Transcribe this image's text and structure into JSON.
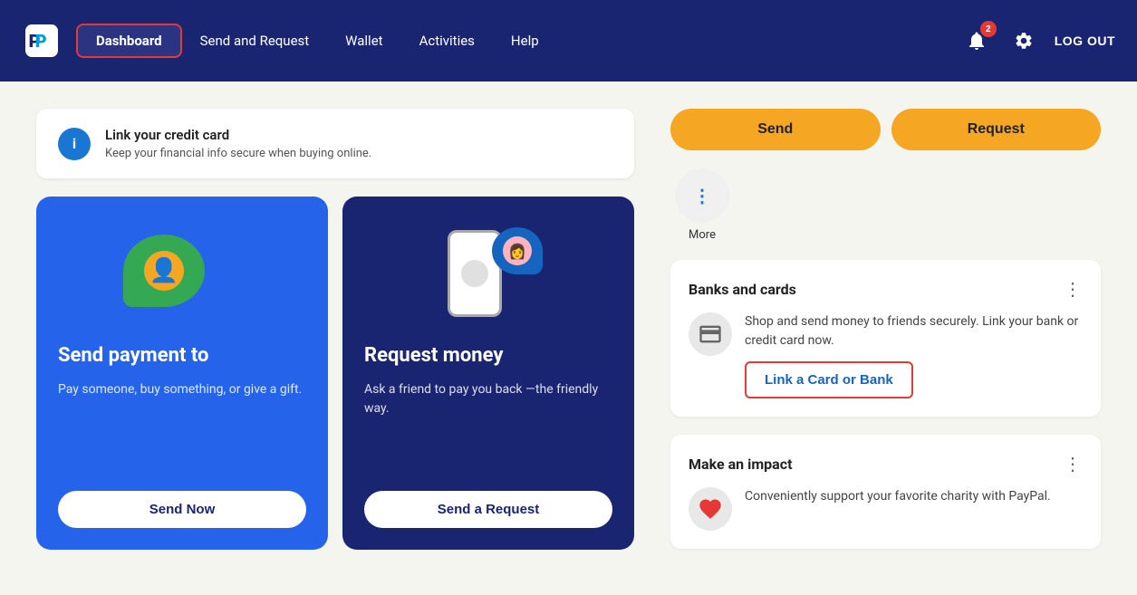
{
  "navbar": {
    "logo_alt": "PayPal",
    "items": [
      {
        "label": "Dashboard",
        "active": true
      },
      {
        "label": "Send and Request",
        "active": false
      },
      {
        "label": "Wallet",
        "active": false
      },
      {
        "label": "Activities",
        "active": false
      },
      {
        "label": "Help",
        "active": false
      }
    ],
    "notification_count": "2",
    "logout_label": "LOG OUT"
  },
  "info_banner": {
    "title": "Link your credit card",
    "description": "Keep your financial info secure when buying online."
  },
  "send_card": {
    "title": "Send payment to",
    "description": "Pay someone, buy something, or give a gift.",
    "button_label": "Send Now"
  },
  "request_card": {
    "title": "Request money",
    "description": "Ask a friend to pay you back —the friendly way.",
    "button_label": "Send a Request"
  },
  "actions": {
    "send_label": "Send",
    "request_label": "Request",
    "more_label": "More"
  },
  "banks_section": {
    "title": "Banks and cards",
    "description": "Shop and send money to friends securely. Link your bank or credit card now.",
    "link_label": "Link a Card or Bank"
  },
  "impact_section": {
    "title": "Make an impact",
    "description": "Conveniently support your favorite charity with PayPal."
  }
}
